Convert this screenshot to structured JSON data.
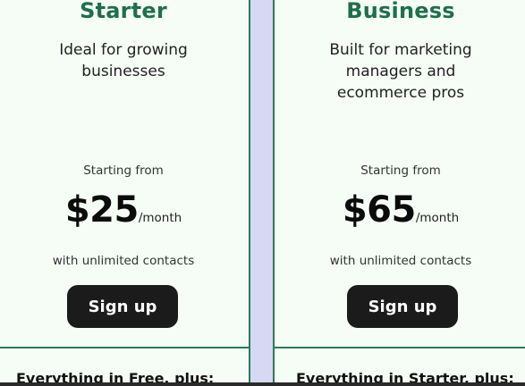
{
  "plans": [
    {
      "title": "Starter",
      "description": "Ideal for growing businesses",
      "starting_label": "Starting from",
      "price": "$25",
      "period": "/month",
      "contacts": "with unlimited contacts",
      "cta": "Sign up",
      "includes": "Everything in Free, plus:"
    },
    {
      "title": "Business",
      "description": "Built for marketing managers and ecommerce pros",
      "starting_label": "Starting from",
      "price": "$65",
      "period": "/month",
      "contacts": "with unlimited contacts",
      "cta": "Sign up",
      "includes": "Everything in Starter, plus:"
    }
  ],
  "colors": {
    "accent_green": "#1e6f4b",
    "card_border": "#2b7a57",
    "card_background": "#f6fdf7",
    "gap_background": "#d6d9f4",
    "button_background": "#1b1b1b"
  }
}
